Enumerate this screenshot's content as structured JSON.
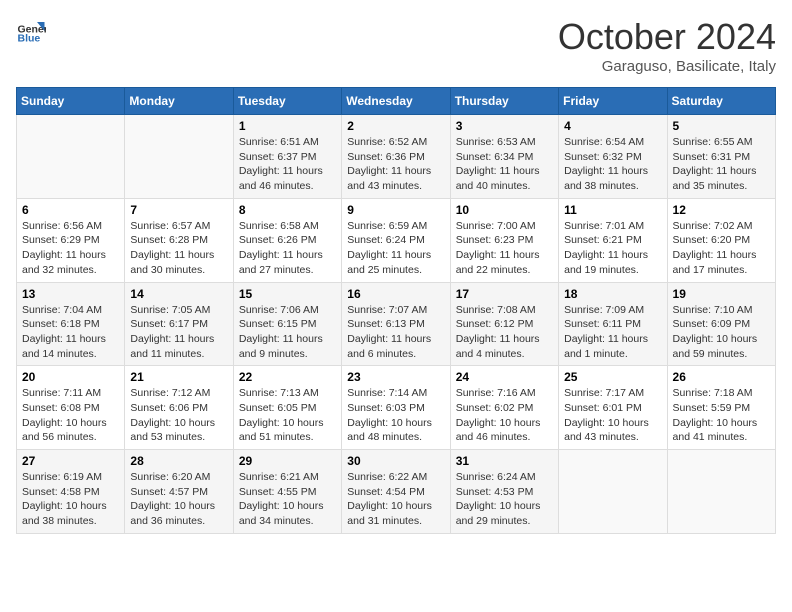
{
  "header": {
    "logo": {
      "line1": "General",
      "line2": "Blue"
    },
    "title": "October 2024",
    "location": "Garaguso, Basilicate, Italy"
  },
  "weekdays": [
    "Sunday",
    "Monday",
    "Tuesday",
    "Wednesday",
    "Thursday",
    "Friday",
    "Saturday"
  ],
  "weeks": [
    [
      {
        "day": "",
        "info": ""
      },
      {
        "day": "",
        "info": ""
      },
      {
        "day": "1",
        "info": "Sunrise: 6:51 AM\nSunset: 6:37 PM\nDaylight: 11 hours and 46 minutes."
      },
      {
        "day": "2",
        "info": "Sunrise: 6:52 AM\nSunset: 6:36 PM\nDaylight: 11 hours and 43 minutes."
      },
      {
        "day": "3",
        "info": "Sunrise: 6:53 AM\nSunset: 6:34 PM\nDaylight: 11 hours and 40 minutes."
      },
      {
        "day": "4",
        "info": "Sunrise: 6:54 AM\nSunset: 6:32 PM\nDaylight: 11 hours and 38 minutes."
      },
      {
        "day": "5",
        "info": "Sunrise: 6:55 AM\nSunset: 6:31 PM\nDaylight: 11 hours and 35 minutes."
      }
    ],
    [
      {
        "day": "6",
        "info": "Sunrise: 6:56 AM\nSunset: 6:29 PM\nDaylight: 11 hours and 32 minutes."
      },
      {
        "day": "7",
        "info": "Sunrise: 6:57 AM\nSunset: 6:28 PM\nDaylight: 11 hours and 30 minutes."
      },
      {
        "day": "8",
        "info": "Sunrise: 6:58 AM\nSunset: 6:26 PM\nDaylight: 11 hours and 27 minutes."
      },
      {
        "day": "9",
        "info": "Sunrise: 6:59 AM\nSunset: 6:24 PM\nDaylight: 11 hours and 25 minutes."
      },
      {
        "day": "10",
        "info": "Sunrise: 7:00 AM\nSunset: 6:23 PM\nDaylight: 11 hours and 22 minutes."
      },
      {
        "day": "11",
        "info": "Sunrise: 7:01 AM\nSunset: 6:21 PM\nDaylight: 11 hours and 19 minutes."
      },
      {
        "day": "12",
        "info": "Sunrise: 7:02 AM\nSunset: 6:20 PM\nDaylight: 11 hours and 17 minutes."
      }
    ],
    [
      {
        "day": "13",
        "info": "Sunrise: 7:04 AM\nSunset: 6:18 PM\nDaylight: 11 hours and 14 minutes."
      },
      {
        "day": "14",
        "info": "Sunrise: 7:05 AM\nSunset: 6:17 PM\nDaylight: 11 hours and 11 minutes."
      },
      {
        "day": "15",
        "info": "Sunrise: 7:06 AM\nSunset: 6:15 PM\nDaylight: 11 hours and 9 minutes."
      },
      {
        "day": "16",
        "info": "Sunrise: 7:07 AM\nSunset: 6:13 PM\nDaylight: 11 hours and 6 minutes."
      },
      {
        "day": "17",
        "info": "Sunrise: 7:08 AM\nSunset: 6:12 PM\nDaylight: 11 hours and 4 minutes."
      },
      {
        "day": "18",
        "info": "Sunrise: 7:09 AM\nSunset: 6:11 PM\nDaylight: 11 hours and 1 minute."
      },
      {
        "day": "19",
        "info": "Sunrise: 7:10 AM\nSunset: 6:09 PM\nDaylight: 10 hours and 59 minutes."
      }
    ],
    [
      {
        "day": "20",
        "info": "Sunrise: 7:11 AM\nSunset: 6:08 PM\nDaylight: 10 hours and 56 minutes."
      },
      {
        "day": "21",
        "info": "Sunrise: 7:12 AM\nSunset: 6:06 PM\nDaylight: 10 hours and 53 minutes."
      },
      {
        "day": "22",
        "info": "Sunrise: 7:13 AM\nSunset: 6:05 PM\nDaylight: 10 hours and 51 minutes."
      },
      {
        "day": "23",
        "info": "Sunrise: 7:14 AM\nSunset: 6:03 PM\nDaylight: 10 hours and 48 minutes."
      },
      {
        "day": "24",
        "info": "Sunrise: 7:16 AM\nSunset: 6:02 PM\nDaylight: 10 hours and 46 minutes."
      },
      {
        "day": "25",
        "info": "Sunrise: 7:17 AM\nSunset: 6:01 PM\nDaylight: 10 hours and 43 minutes."
      },
      {
        "day": "26",
        "info": "Sunrise: 7:18 AM\nSunset: 5:59 PM\nDaylight: 10 hours and 41 minutes."
      }
    ],
    [
      {
        "day": "27",
        "info": "Sunrise: 6:19 AM\nSunset: 4:58 PM\nDaylight: 10 hours and 38 minutes."
      },
      {
        "day": "28",
        "info": "Sunrise: 6:20 AM\nSunset: 4:57 PM\nDaylight: 10 hours and 36 minutes."
      },
      {
        "day": "29",
        "info": "Sunrise: 6:21 AM\nSunset: 4:55 PM\nDaylight: 10 hours and 34 minutes."
      },
      {
        "day": "30",
        "info": "Sunrise: 6:22 AM\nSunset: 4:54 PM\nDaylight: 10 hours and 31 minutes."
      },
      {
        "day": "31",
        "info": "Sunrise: 6:24 AM\nSunset: 4:53 PM\nDaylight: 10 hours and 29 minutes."
      },
      {
        "day": "",
        "info": ""
      },
      {
        "day": "",
        "info": ""
      }
    ]
  ]
}
